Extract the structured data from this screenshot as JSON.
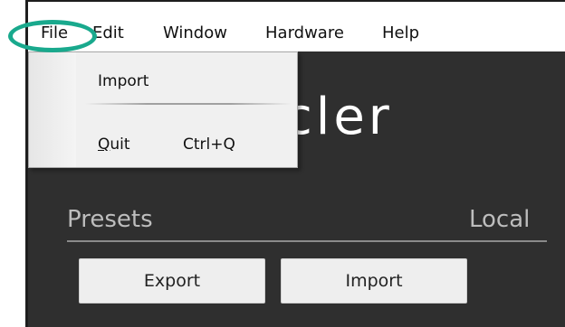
{
  "menubar": {
    "items": [
      {
        "label": "File"
      },
      {
        "label": "Edit"
      },
      {
        "label": "Window"
      },
      {
        "label": "Hardware"
      },
      {
        "label": "Help"
      }
    ]
  },
  "file_menu": {
    "import_label": "Import",
    "quit_label": "Quit",
    "quit_shortcut": "Ctrl+Q"
  },
  "app": {
    "logo_text": "cler",
    "presets_title": "Presets",
    "local_title": "Local",
    "export_button": "Export",
    "import_button": "Import"
  },
  "colors": {
    "highlight": "#19a98d",
    "app_background": "#2f2f2f"
  }
}
